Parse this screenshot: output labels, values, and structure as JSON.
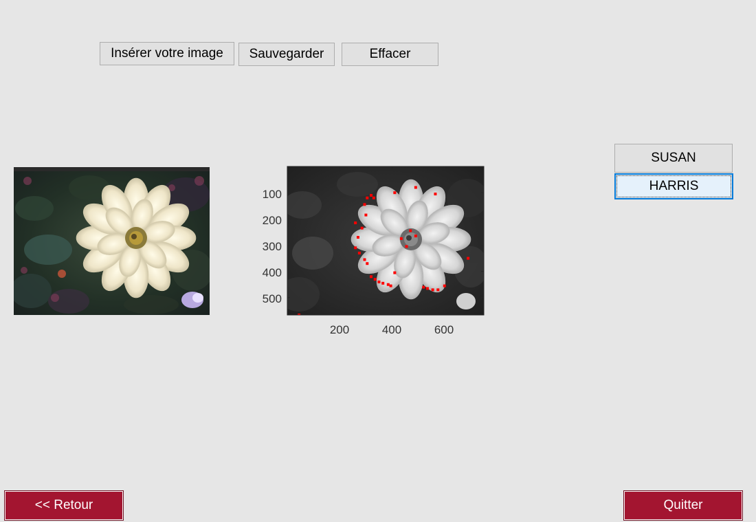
{
  "toolbar": {
    "insert_label": "Insérer votre image",
    "save_label": "Sauvegarder",
    "clear_label": "Effacer"
  },
  "detectors": {
    "susan_label": "SUSAN",
    "harris_label": "HARRIS",
    "selected": "HARRIS"
  },
  "plot": {
    "y_ticks": [
      "100",
      "200",
      "300",
      "400",
      "500"
    ],
    "x_ticks": [
      "200",
      "400",
      "600"
    ],
    "x_tick_values": [
      200,
      400,
      600
    ],
    "y_tick_values": [
      100,
      200,
      300,
      400,
      500
    ],
    "xlim": [
      0,
      750
    ],
    "ylim": [
      0,
      566
    ],
    "marker_color": "#ff0000",
    "corner_points": [
      [
        305,
        120
      ],
      [
        320,
        110
      ],
      [
        295,
        145
      ],
      [
        330,
        120
      ],
      [
        410,
        100
      ],
      [
        490,
        80
      ],
      [
        565,
        105
      ],
      [
        300,
        185
      ],
      [
        260,
        215
      ],
      [
        285,
        235
      ],
      [
        270,
        270
      ],
      [
        260,
        310
      ],
      [
        275,
        330
      ],
      [
        295,
        355
      ],
      [
        305,
        370
      ],
      [
        320,
        420
      ],
      [
        335,
        430
      ],
      [
        350,
        440
      ],
      [
        365,
        445
      ],
      [
        385,
        450
      ],
      [
        395,
        455
      ],
      [
        410,
        405
      ],
      [
        455,
        305
      ],
      [
        470,
        245
      ],
      [
        490,
        265
      ],
      [
        435,
        275
      ],
      [
        520,
        460
      ],
      [
        535,
        465
      ],
      [
        555,
        470
      ],
      [
        575,
        470
      ],
      [
        600,
        455
      ],
      [
        690,
        350
      ],
      [
        45,
        566
      ]
    ]
  },
  "footer": {
    "back_label": "<< Retour",
    "quit_label": "Quitter"
  },
  "colors": {
    "background": "#e6e6e6",
    "button_face": "#e1e1e1",
    "accent_dark": "#a31530",
    "selected_face": "#e5f1fb",
    "focus_border": "#0078d7"
  }
}
